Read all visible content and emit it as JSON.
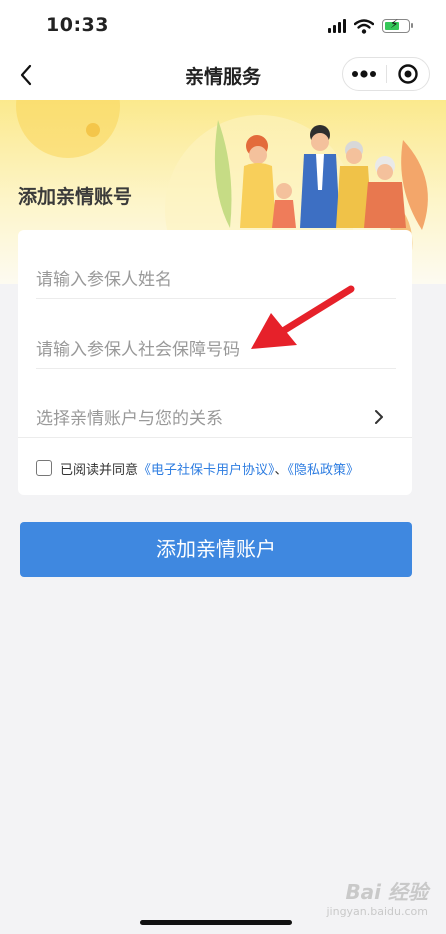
{
  "status_bar": {
    "time": "10:33"
  },
  "nav": {
    "title": "亲情服务"
  },
  "banner": {
    "title": "添加亲情账号"
  },
  "form": {
    "name_placeholder": "请输入参保人姓名",
    "id_placeholder": "请输入参保人社会保障号码",
    "relation_label": "选择亲情账户与您的关系",
    "agreement": {
      "checked": false,
      "prefix": "已阅读并同意",
      "link1": "《电子社保卡用户协议》",
      "separator": "、",
      "link2": "《隐私政策》"
    }
  },
  "submit_button": "添加亲情账户",
  "watermark": {
    "brand": "Bai 经验",
    "url": "jingyan.baidu.com"
  },
  "colors": {
    "primary": "#3f88e0",
    "link": "#2e7de1",
    "arrow": "#e6212a",
    "banner": "#fbe98d"
  }
}
